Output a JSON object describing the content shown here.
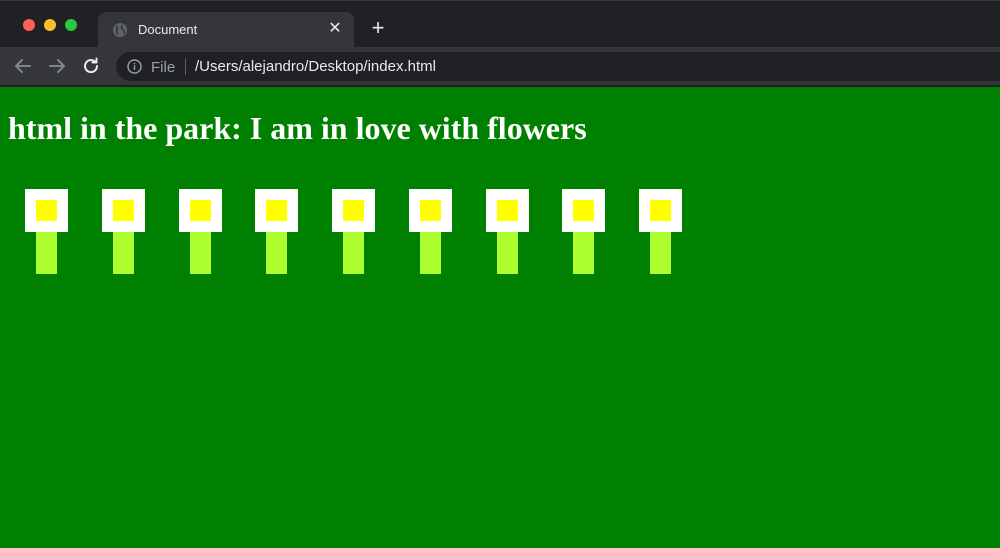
{
  "window": {
    "tab": {
      "title": "Document",
      "icon": "globe-icon"
    },
    "new_tab_label": "+",
    "close_label": "✕"
  },
  "toolbar": {
    "back_icon": "back-arrow-icon",
    "forward_icon": "forward-arrow-icon",
    "reload_icon": "reload-icon",
    "address": {
      "scheme_label": "File",
      "url": "/Users/alejandro/Desktop/index.html"
    }
  },
  "page": {
    "background_color": "#008000",
    "heading": "html in the park: I am in love with flowers",
    "flower_count": 9,
    "colors": {
      "petal": "#ffffff",
      "center": "#ffff00",
      "stem": "#adff2f"
    }
  }
}
